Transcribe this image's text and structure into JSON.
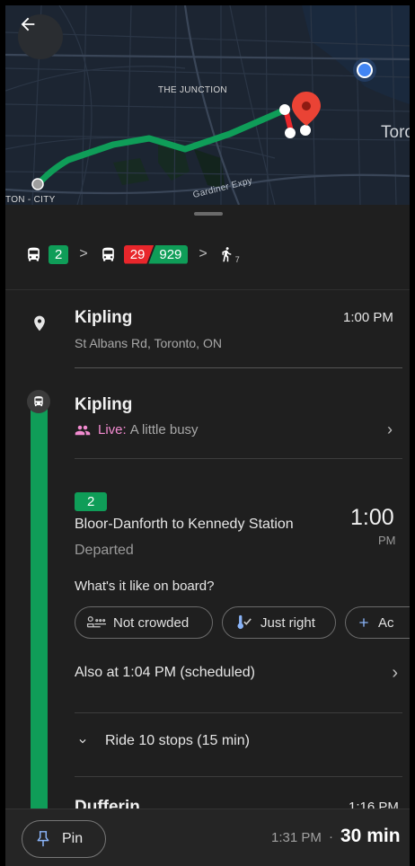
{
  "map": {
    "label_junction": "THE JUNCTION",
    "label_toronto": "Toro",
    "label_expressway": "Gardiner Expy",
    "label_city": "TON - CITY"
  },
  "summary": {
    "leg1_route": "2",
    "leg2_route_a": "29",
    "leg2_route_b": "929",
    "walk_minutes": "7",
    "separator": ">"
  },
  "origin": {
    "title": "Kipling",
    "address": "St Albans Rd, Toronto, ON",
    "time": "1:00 PM"
  },
  "station": {
    "title": "Kipling",
    "live_label": "Live:",
    "crowd_status": "A little busy"
  },
  "trip": {
    "route_badge": "2",
    "headsign": "Bloor-Danforth to Kennedy Station",
    "status": "Departed",
    "time": "1:00",
    "time_period": "PM",
    "onboard_question": "What's it like on board?",
    "chips": [
      "Not crowded",
      "Just right",
      "Ac"
    ],
    "also_at": "Also at 1:04 PM (scheduled)",
    "ride_stops": "Ride 10 stops (15 min)"
  },
  "next_stop": {
    "title": "Dufferin",
    "time": "1:16 PM"
  },
  "bottom": {
    "pin_label": "Pin",
    "arrival_time": "1:31 PM",
    "dot": "·",
    "duration": "30 min"
  },
  "colors": {
    "route_green": "#0f9d58",
    "route_red": "#e8262b",
    "live_pink": "#f28bd0",
    "background": "#1f1f1f"
  }
}
